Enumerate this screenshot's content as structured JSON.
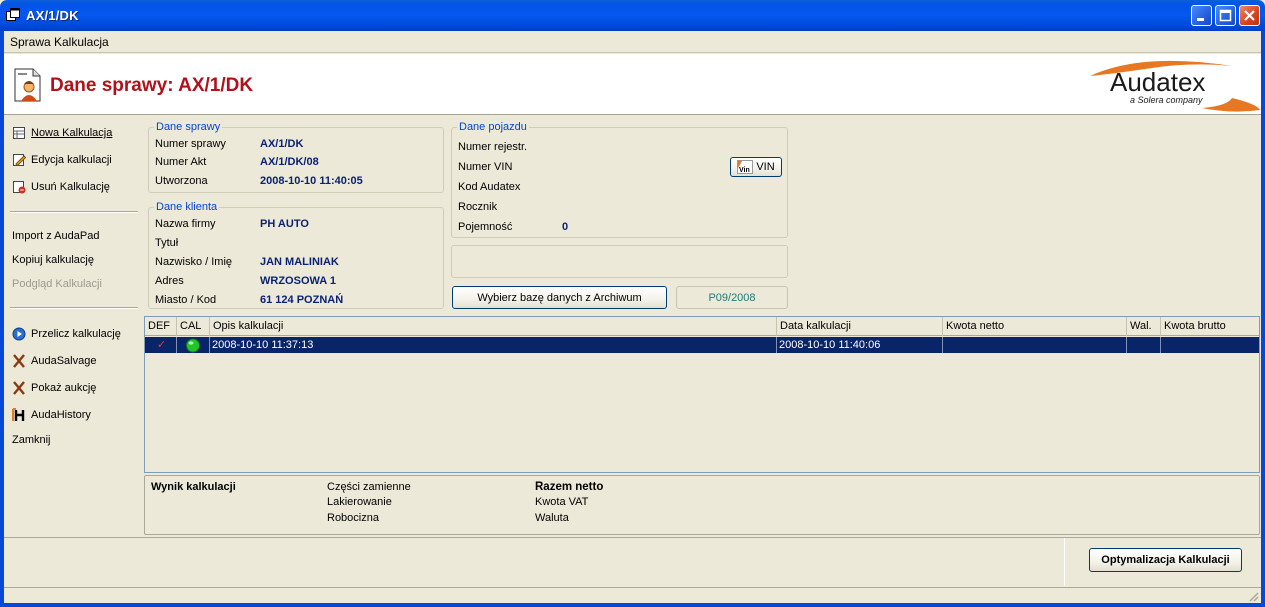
{
  "window": {
    "title": "AX/1/DK"
  },
  "menu": {
    "items": [
      "Sprawa",
      "Kalkulacja"
    ]
  },
  "header": {
    "title": "Dane sprawy: AX/1/DK",
    "logo_text": "Audatex",
    "logo_subtext": "a Solera company"
  },
  "sidebar": {
    "group1": [
      "Nowa Kalkulacja",
      "Edycja kalkulacji",
      "Usuń Kalkulację"
    ],
    "group2": [
      "Import z AudaPad",
      "Kopiuj kalkulację",
      "Podgląd Kalkulacji"
    ],
    "group3": [
      "Przelicz kalkulację",
      "AudaSalvage",
      "Pokaż aukcję",
      "AudaHistory",
      "Zamknij"
    ]
  },
  "dane_sprawy": {
    "legend": "Dane sprawy",
    "rows": [
      {
        "label": "Numer sprawy",
        "value": "AX/1/DK"
      },
      {
        "label": "Numer Akt",
        "value": "AX/1/DK/08"
      },
      {
        "label": "Utworzona",
        "value": "2008-10-10 11:40:05"
      }
    ]
  },
  "dane_klienta": {
    "legend": "Dane klienta",
    "rows": [
      {
        "label": "Nazwa firmy",
        "value": "PH AUTO"
      },
      {
        "label": "Tytuł",
        "value": ""
      },
      {
        "label": "Nazwisko / Imię",
        "value": "JAN MALINIAK"
      },
      {
        "label": "Adres",
        "value": "WRZOSOWA 1"
      },
      {
        "label": "Miasto / Kod",
        "value": "61 124 POZNAŃ"
      }
    ]
  },
  "dane_pojazdu": {
    "legend": "Dane pojazdu",
    "rows": [
      {
        "label": "Numer rejestr.",
        "value": ""
      },
      {
        "label": "Numer VIN",
        "value": ""
      },
      {
        "label": "Kod Audatex",
        "value": ""
      },
      {
        "label": "Rocznik",
        "value": ""
      },
      {
        "label": "Pojemność",
        "value": "0"
      }
    ],
    "vin_button": "VIN",
    "vin_icon_text": "Vin"
  },
  "archive": {
    "button": "Wybierz bazę danych z Archiwum",
    "period": "P09/2008"
  },
  "table": {
    "headers": [
      "DEF",
      "CAL",
      "Opis kalkulacji",
      "Data kalkulacji",
      "Kwota netto",
      "Wal.",
      "Kwota brutto"
    ],
    "rows": [
      {
        "def": "✓",
        "opis": "2008-10-10 11:37:13",
        "data": "2008-10-10 11:40:06",
        "netto": "",
        "wal": "",
        "brutto": ""
      }
    ]
  },
  "result": {
    "title": "Wynik kalkulacji",
    "col1": [
      "Części zamienne",
      "Lakierowanie",
      "Robocizna"
    ],
    "col2_title": "Razem netto",
    "col2": [
      "Kwota VAT",
      "Waluta"
    ]
  },
  "footer": {
    "optimize_button": "Optymalizacja Kalkulacji"
  },
  "colors": {
    "title_red": "#b0111a",
    "value_blue": "#0a2274",
    "legend_blue": "#0046d5",
    "selection": "#0a246a",
    "period_teal": "#1b7d7d"
  }
}
